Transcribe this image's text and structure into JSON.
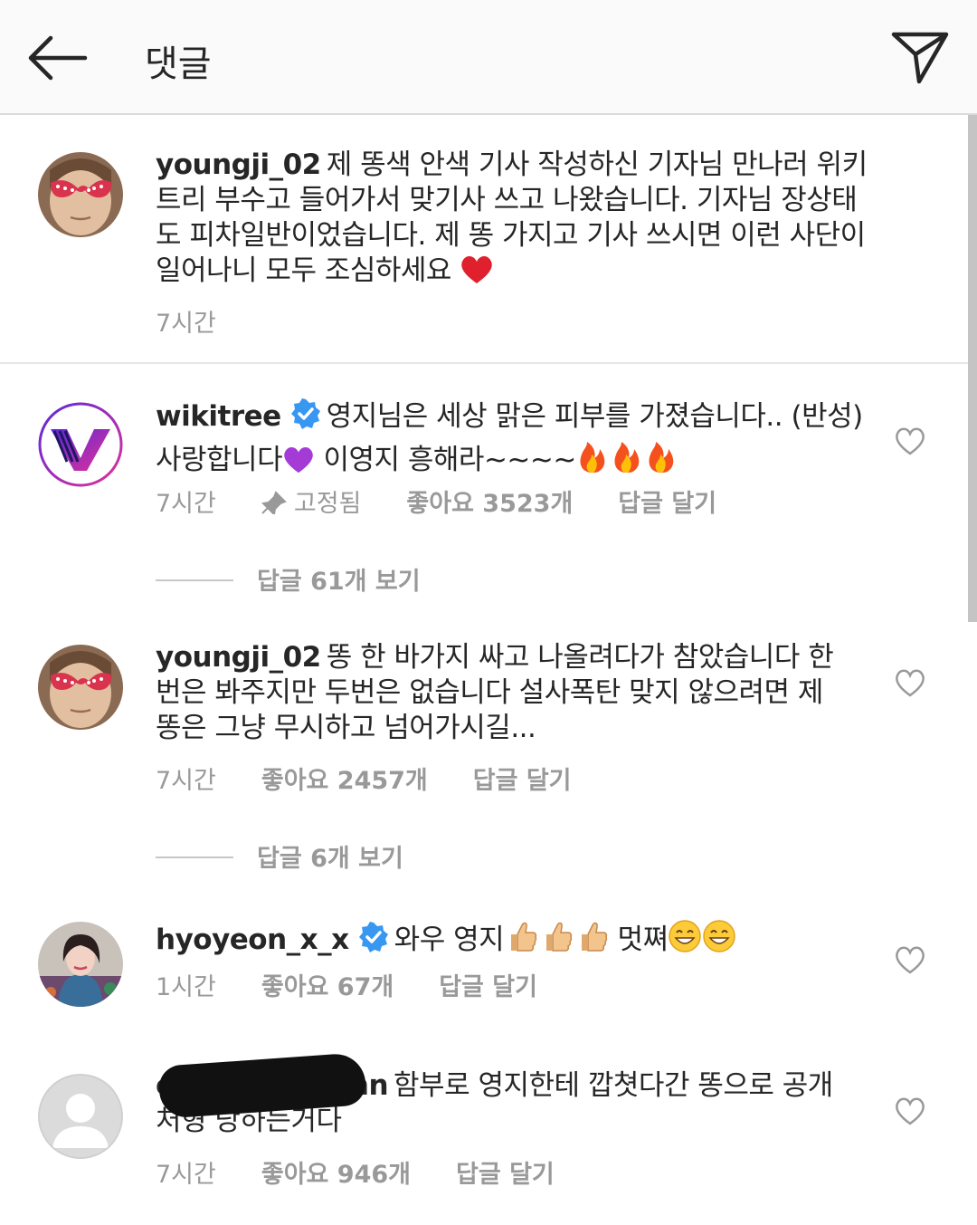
{
  "header": {
    "title": "댓글"
  },
  "caption": {
    "username": "youngji_02",
    "text": "제 똥색 안색 기사 작성하신 기자님 만나러 위키트리 부수고 들어가서 맞기사 쓰고 나왔습니다. 기자님 장상태도 피차일반이었습니다. 제 똥 가지고 기사 쓰시면 이런 사단이 일어나니 모두 조심하세요",
    "emoji": "red-heart-emoji",
    "time": "7시간"
  },
  "comments": [
    {
      "username": "wikitree",
      "verified": true,
      "text": "영지님은 세상 맑은 피부를 가졌습니다.. (반성) 사랑합니다",
      "text_after": "이영지 흥해라~~~~",
      "time": "7시간",
      "pinned": "고정됨",
      "likes": "좋아요 3523개",
      "reply": "답글 달기",
      "view_replies": "답글 61개 보기"
    },
    {
      "username": "youngji_02",
      "verified": false,
      "text": "똥 한 바가지 싸고 나올려다가 참았습니다 한번은 봐주지만 두번은 없습니다 설사폭탄 맞지 않으려면 제 똥은 그냥 무시하고 넘어가시길...",
      "time": "7시간",
      "likes": "좋아요 2457개",
      "reply": "답글 달기",
      "view_replies": "답글 6개 보기"
    },
    {
      "username": "hyoyeon_x_x",
      "verified": true,
      "text": "와우 영지",
      "text_after": "멋쪄",
      "time": "1시간",
      "likes": "좋아요 67개",
      "reply": "답글 달기"
    },
    {
      "username_visible_start": "c",
      "username_visible_end": "nn",
      "text": "함부로 영지한테 깝쳣다간 똥으로 공개처형 당하는거다",
      "time": "7시간",
      "likes": "좋아요 946개",
      "reply": "답글 달기"
    }
  ],
  "colors": {
    "header_bg": "#fafafa",
    "text": "#262626",
    "meta": "#999999",
    "verified": "#3897f0"
  }
}
